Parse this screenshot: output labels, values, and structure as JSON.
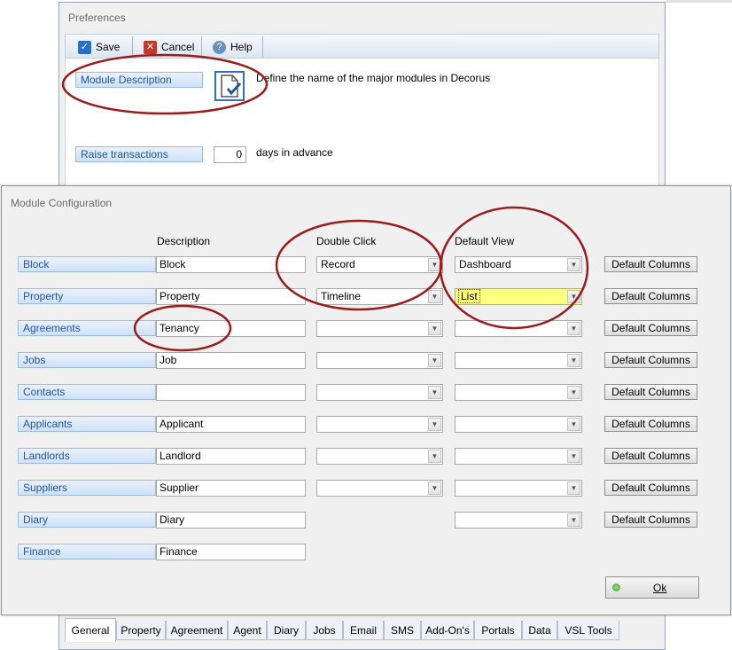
{
  "preferences": {
    "title": "Preferences",
    "toolbar": {
      "save": "Save",
      "cancel": "Cancel",
      "help": "Help"
    },
    "module_description_label": "Module Description",
    "module_description_text": "Define the name of the major modules in Decorus",
    "raise_transactions_label": "Raise transactions",
    "raise_transactions_value": "0",
    "raise_transactions_suffix": "days in advance",
    "tabs": [
      "General",
      "Property",
      "Agreement",
      "Agent",
      "Diary",
      "Jobs",
      "Email",
      "SMS",
      "Add-On's",
      "Portals",
      "Data",
      "VSL Tools"
    ]
  },
  "module_config": {
    "title": "Module Configuration",
    "headers": {
      "description": "Description",
      "double_click": "Double Click",
      "default_view": "Default View"
    },
    "default_columns_label": "Default Columns",
    "ok_label": "Ok",
    "rows": [
      {
        "module": "Block",
        "description": "Block",
        "double_click": "Record",
        "default_view": "Dashboard"
      },
      {
        "module": "Property",
        "description": "Property",
        "double_click": "Timeline",
        "default_view": "List"
      },
      {
        "module": "Agreements",
        "description": "Tenancy",
        "double_click": "",
        "default_view": ""
      },
      {
        "module": "Jobs",
        "description": "Job",
        "double_click": "",
        "default_view": ""
      },
      {
        "module": "Contacts",
        "description": "",
        "double_click": "",
        "default_view": ""
      },
      {
        "module": "Applicants",
        "description": "Applicant",
        "double_click": "",
        "default_view": ""
      },
      {
        "module": "Landlords",
        "description": "Landlord",
        "double_click": "",
        "default_view": ""
      },
      {
        "module": "Suppliers",
        "description": "Supplier",
        "double_click": "",
        "default_view": ""
      },
      {
        "module": "Diary",
        "description": "Diary",
        "default_view": ""
      },
      {
        "module": "Finance",
        "description": "Finance"
      }
    ]
  },
  "colors": {
    "annotation": "#9b1c1c",
    "label_text": "#1f56a8",
    "highlight": "#ffff80"
  }
}
